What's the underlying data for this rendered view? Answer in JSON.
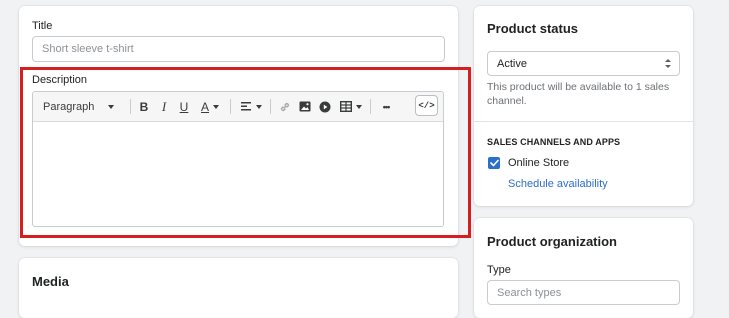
{
  "main": {
    "title_label": "Title",
    "title_value": "Short sleeve t-shirt",
    "description_label": "Description",
    "toolbar": {
      "format_select": "Paragraph",
      "buttons": [
        "bold",
        "italic",
        "underline",
        "text-color",
        "align",
        "link",
        "image",
        "video",
        "table",
        "more",
        "show-html"
      ],
      "bold_glyph": "B",
      "italic_glyph": "I",
      "underline_glyph": "U",
      "text_color_glyph": "A",
      "more_glyph": "•••",
      "code_glyph": "</>"
    },
    "highlight_color": "#d31f1f"
  },
  "media": {
    "heading": "Media"
  },
  "status": {
    "heading": "Product status",
    "select_value": "Active",
    "help_text": "This product will be available to 1 sales channel.",
    "channels_heading": "SALES CHANNELS AND APPS",
    "channel_label": "Online Store",
    "channel_checked": true,
    "schedule_link": "Schedule availability"
  },
  "organization": {
    "heading": "Product organization",
    "type_label": "Type",
    "type_placeholder": "Search types"
  },
  "colors": {
    "accent": "#2c6ecb",
    "background": "#f1f2f4"
  }
}
